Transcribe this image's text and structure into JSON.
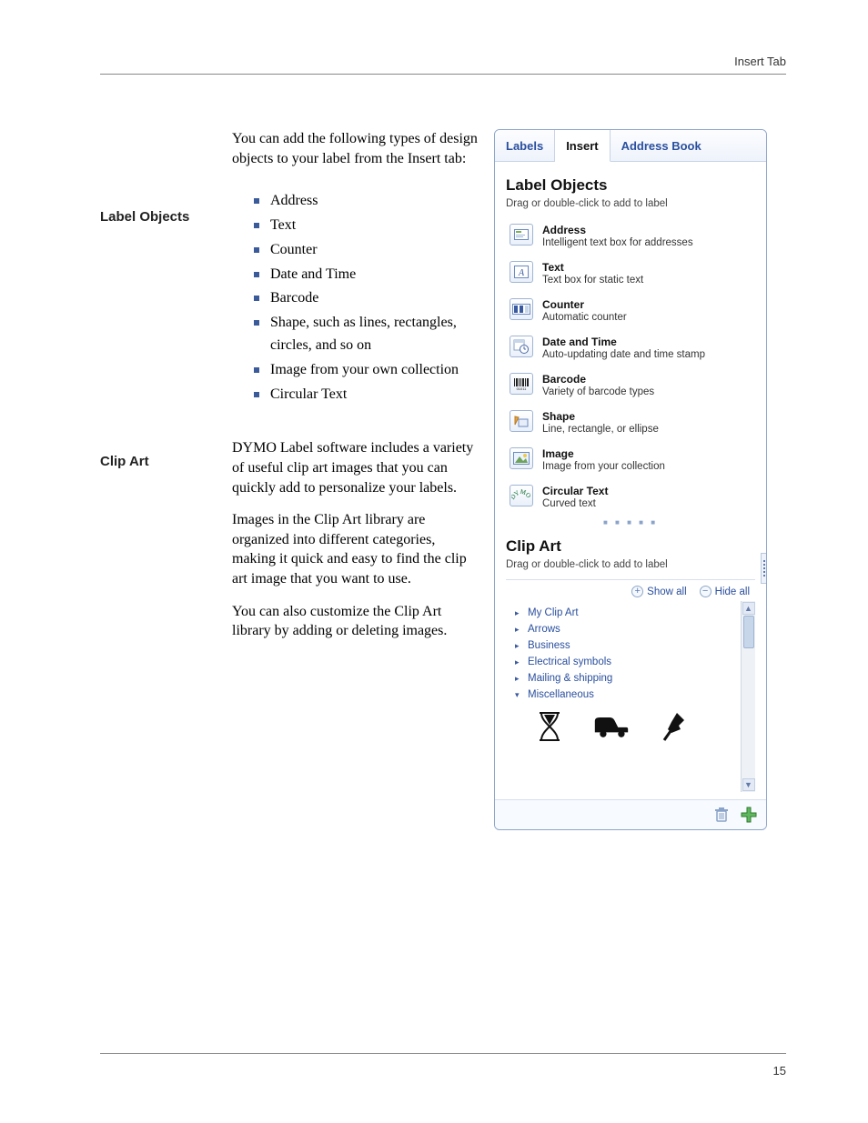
{
  "header": {
    "breadcrumb": "Insert Tab"
  },
  "intro": "You can add the following types of design objects to your label from the Insert tab:",
  "sections": {
    "label_objects_heading": "Label Objects",
    "clip_art_heading": "Clip Art"
  },
  "bullets": [
    "Address",
    "Text",
    "Counter",
    "Date and Time",
    "Barcode",
    "Shape, such as lines, rectangles, circles, and so on",
    "Image from your own collection",
    "Circular Text"
  ],
  "clipart_paragraphs": [
    "DYMO Label software includes a variety of useful clip art images that you can quickly add to personalize your labels.",
    "Images in the Clip Art library are organized into different categories, making it quick and easy to find the clip art image that you want to use.",
    "You can also customize the Clip Art library by adding or deleting images."
  ],
  "panel": {
    "tabs": {
      "labels": "Labels",
      "insert": "Insert",
      "address_book": "Address Book"
    },
    "label_objects": {
      "title": "Label Objects",
      "hint": "Drag or double-click to add to label",
      "items": [
        {
          "title": "Address",
          "desc": "Intelligent text box for addresses"
        },
        {
          "title": "Text",
          "desc": "Text box for static text"
        },
        {
          "title": "Counter",
          "desc": "Automatic counter"
        },
        {
          "title": "Date and Time",
          "desc": "Auto-updating date and time stamp"
        },
        {
          "title": "Barcode",
          "desc": "Variety of barcode types"
        },
        {
          "title": "Shape",
          "desc": "Line, rectangle, or ellipse"
        },
        {
          "title": "Image",
          "desc": "Image from your collection"
        },
        {
          "title": "Circular Text",
          "desc": "Curved text"
        }
      ]
    },
    "clip_art": {
      "title": "Clip Art",
      "hint": "Drag or double-click to add to label",
      "show_all": "Show all",
      "hide_all": "Hide all",
      "categories": [
        "My Clip Art",
        "Arrows",
        "Business",
        "Electrical symbols",
        "Mailing & shipping",
        "Miscellaneous"
      ]
    }
  },
  "page_number": "15"
}
